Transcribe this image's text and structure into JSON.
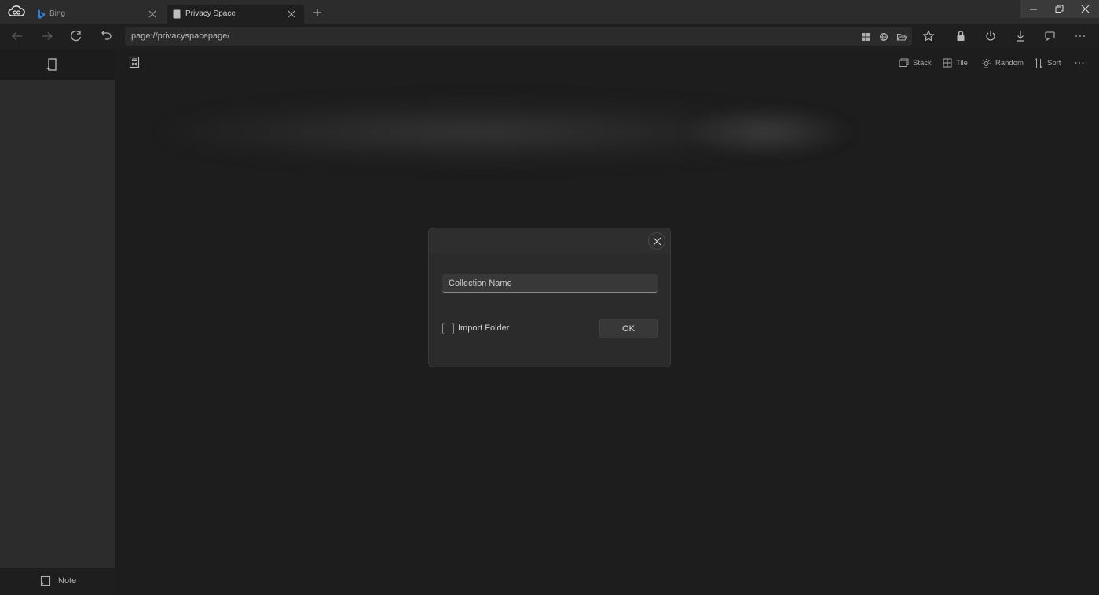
{
  "tabs": [
    {
      "title": "Bing",
      "icon": "bing-icon",
      "active": false
    },
    {
      "title": "Privacy Space",
      "icon": "page-icon",
      "active": true
    }
  ],
  "address": {
    "url": "page://privacyspacepage/"
  },
  "view_options": {
    "stack": "Stack",
    "tile": "Tile",
    "random": "Random",
    "sort": "Sort"
  },
  "sidebar": {
    "note_label": "Note"
  },
  "dialog": {
    "input_placeholder": "Collection Name",
    "checkbox_label": "Import Folder",
    "checkbox_checked": false,
    "ok_label": "OK"
  },
  "colors": {
    "background": "#1d1d1d",
    "sidebar": "#2c2c2c",
    "dialog": "#2b2b2b"
  }
}
